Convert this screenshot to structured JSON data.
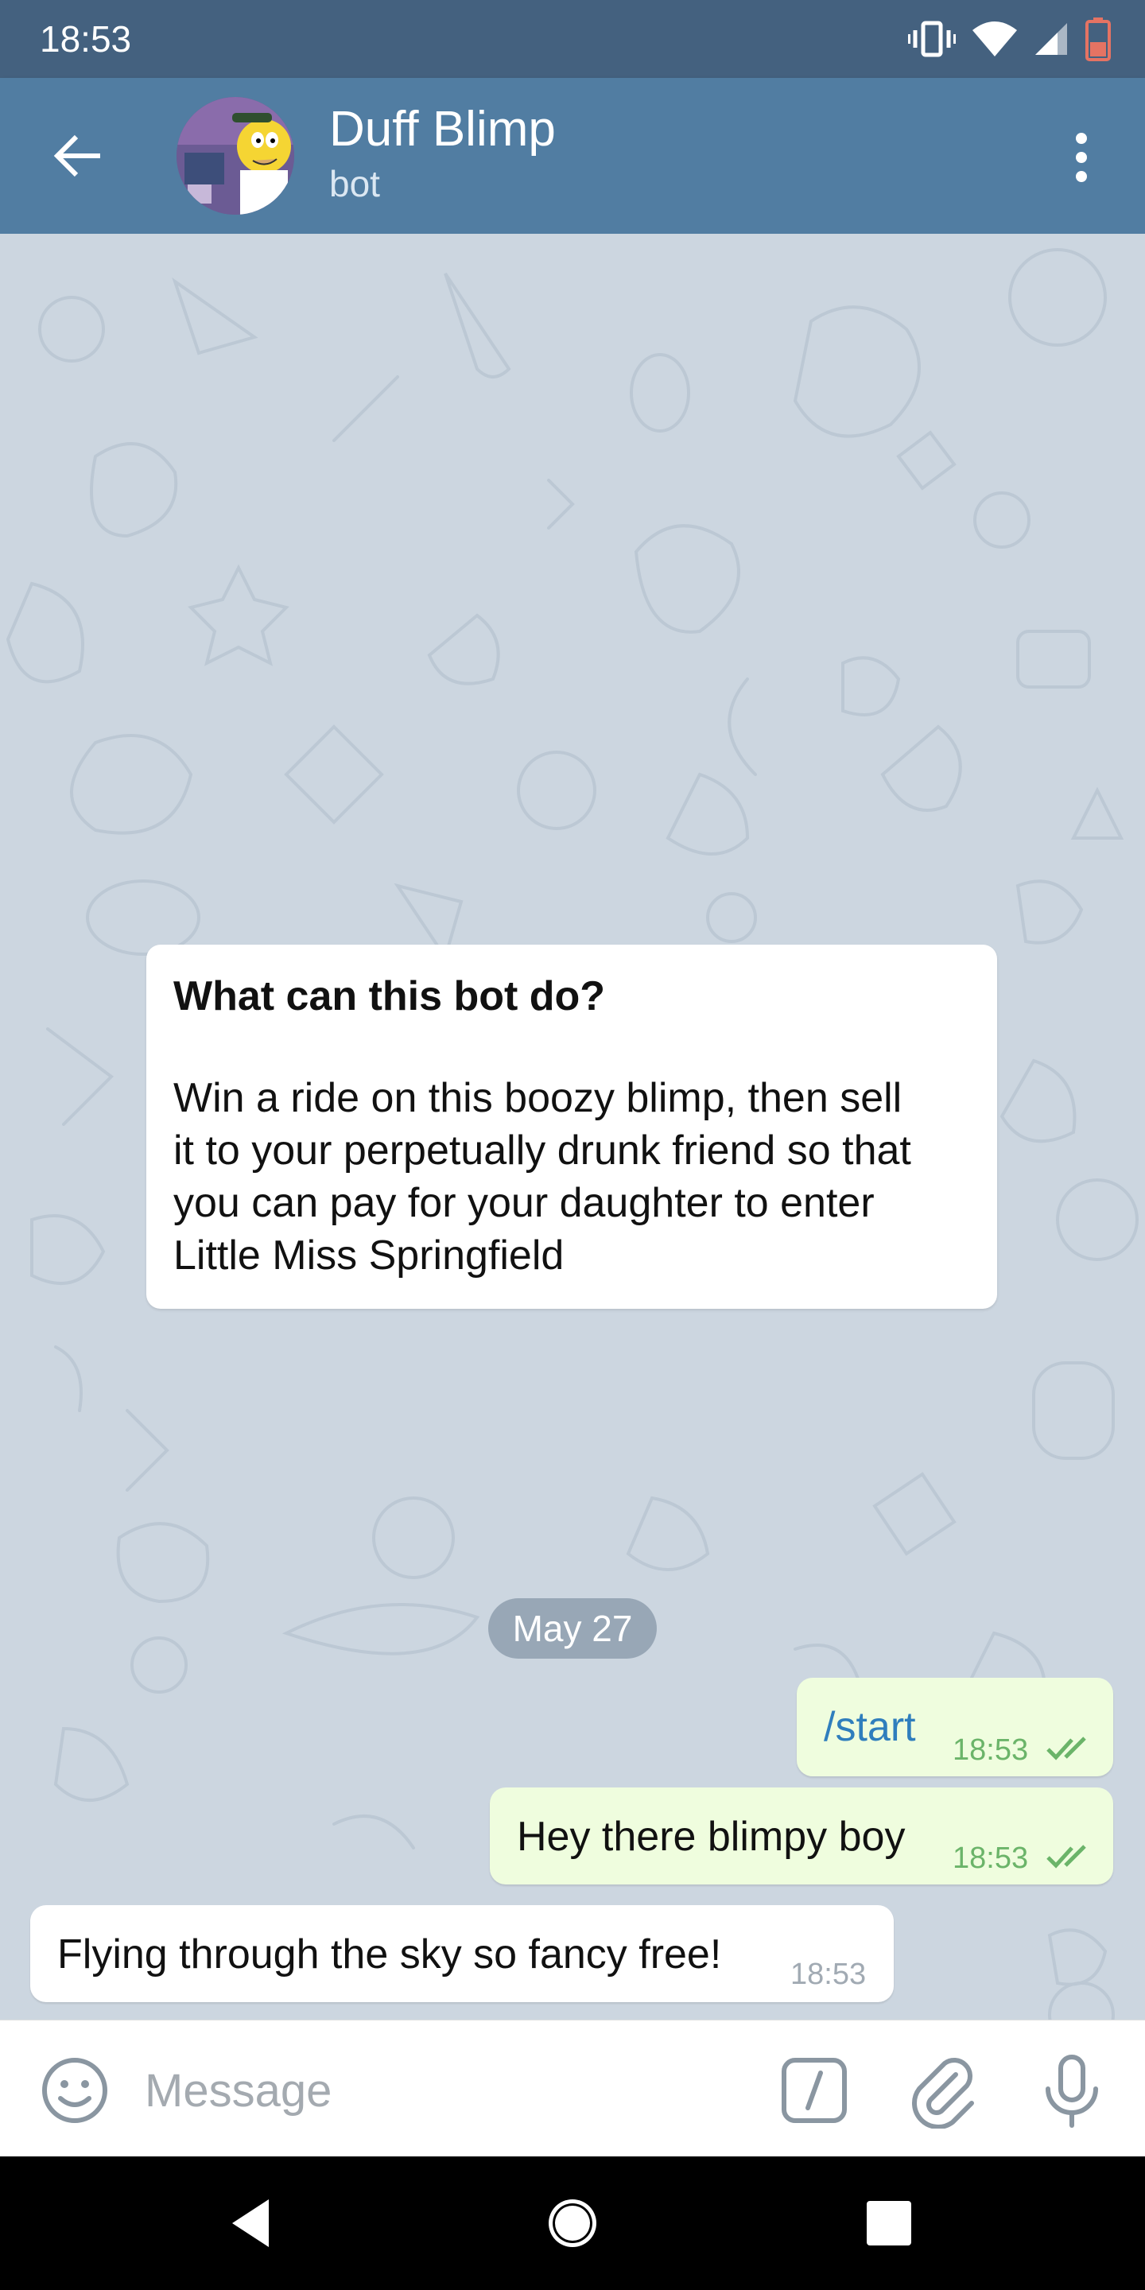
{
  "status_bar": {
    "time": "18:53"
  },
  "header": {
    "title": "Duff Blimp",
    "subtitle": "bot"
  },
  "chat": {
    "bot_info": {
      "title": "What can this bot do?",
      "lines": [
        "Win a ride on this boozy blimp, then sell",
        "it to your perpetually drunk friend so that",
        "you can pay for your daughter to enter",
        "Little Miss Springfield"
      ]
    },
    "date_label": "May 27",
    "messages": [
      {
        "direction": "out",
        "text": "/start",
        "time": "18:53",
        "status": "read"
      },
      {
        "direction": "out",
        "text": "Hey there blimpy boy",
        "time": "18:53",
        "status": "read"
      },
      {
        "direction": "in",
        "text": "Flying through the sky so fancy free!",
        "time": "18:53"
      }
    ]
  },
  "input": {
    "placeholder": "Message"
  },
  "colors": {
    "header": "#517da2",
    "status_bar": "#44617f",
    "wallpaper": "#ccd6e0",
    "outgoing_bubble": "#effdde",
    "command_link": "#2f7ebd",
    "read_tick": "#6bb469"
  },
  "icons": {
    "status": [
      "vibrate-icon",
      "wifi-icon",
      "signal-icon",
      "battery-icon"
    ],
    "header": [
      "back-arrow-icon",
      "more-vert-icon"
    ],
    "input": [
      "emoji-icon",
      "bot-command-icon",
      "attach-icon",
      "mic-icon"
    ],
    "nav": [
      "nav-back-icon",
      "nav-home-icon",
      "nav-recents-icon"
    ]
  }
}
